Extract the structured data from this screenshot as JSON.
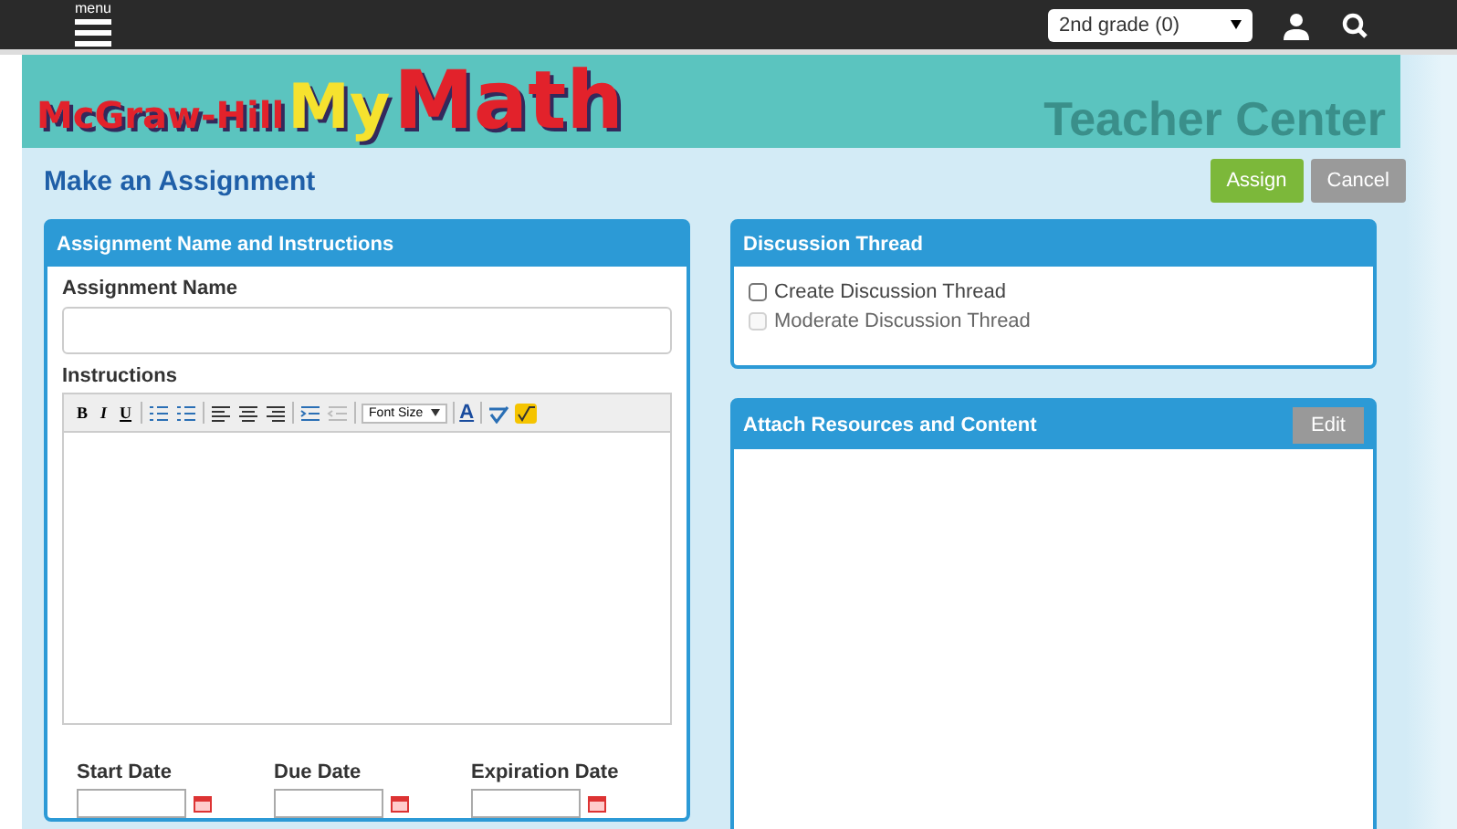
{
  "top_bar": {
    "menu_label": "menu",
    "grade_select": "2nd grade (0)"
  },
  "banner": {
    "logo_parts": [
      "McGraw-Hill",
      "My",
      "Math"
    ],
    "subtitle": "Teacher Center"
  },
  "page_title": "Make an Assignment",
  "actions": [
    {
      "label": "Assign",
      "kind": "primary"
    },
    {
      "label": "Cancel",
      "kind": "secondary"
    }
  ],
  "assignment_panel": {
    "title": "Assignment Name and Instructions",
    "name_label": "Assignment Name",
    "instructions_label": "Instructions",
    "format_buttons": [
      "B",
      "I",
      "U"
    ],
    "font_size_select": "Font Size",
    "color_button": "A",
    "dates": [
      {
        "label": "Start Date"
      },
      {
        "label": "Due Date"
      },
      {
        "label": "Expiration Date"
      }
    ]
  },
  "discussion_panel": {
    "title": "Discussion Thread",
    "options": [
      {
        "label": "Create Discussion Thread",
        "checked": false,
        "disabled": false
      },
      {
        "label": "Moderate Discussion Thread",
        "checked": false,
        "disabled": true
      }
    ]
  },
  "resources_panel": {
    "title": "Attach Resources and Content",
    "button": "Edit"
  }
}
